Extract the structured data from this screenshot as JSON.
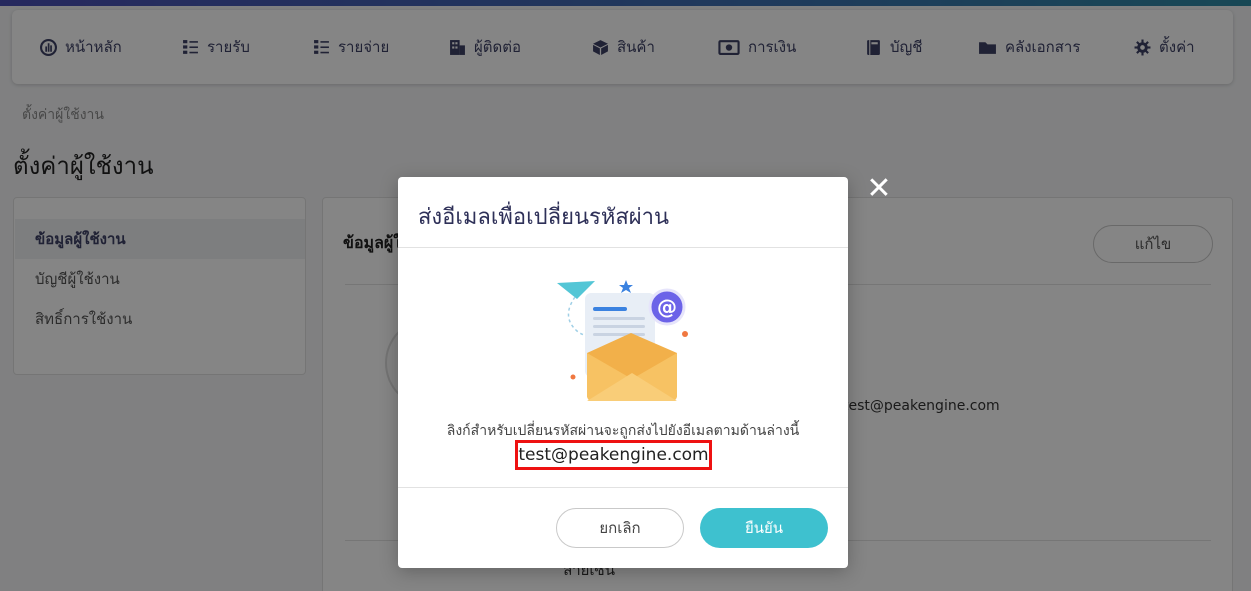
{
  "nav": {
    "items": [
      {
        "label": "หน้าหลัก",
        "icon": "dashboard-icon"
      },
      {
        "label": "รายรับ",
        "icon": "income-list-icon"
      },
      {
        "label": "รายจ่าย",
        "icon": "expense-list-icon"
      },
      {
        "label": "ผู้ติดต่อ",
        "icon": "contacts-building-icon"
      },
      {
        "label": "สินค้า",
        "icon": "product-box-icon"
      },
      {
        "label": "การเงิน",
        "icon": "money-icon"
      },
      {
        "label": "บัญชี",
        "icon": "ledger-book-icon"
      },
      {
        "label": "คลังเอกสาร",
        "icon": "folder-icon"
      },
      {
        "label": "ตั้งค่า",
        "icon": "gear-icon"
      }
    ]
  },
  "breadcrumb": "ตั้งค่าผู้ใช้งาน",
  "page_title": "ตั้งค่าผู้ใช้งาน",
  "sidebar": {
    "items": [
      {
        "label": "ข้อมูลผู้ใช้งาน",
        "active": true
      },
      {
        "label": "บัญชีผู้ใช้งาน",
        "active": false
      },
      {
        "label": "สิทธิ์การใช้งาน",
        "active": false
      }
    ]
  },
  "main": {
    "title": "ข้อมูลผู้ใช้งาน",
    "edit_label": "แก้ไข",
    "email_partial": "test@peakengine.com",
    "bottom_label": "ลายเซ็น"
  },
  "modal": {
    "title": "ส่งอีเมลเพื่อเปลี่ยนรหัสผ่าน",
    "description": "ลิงก์สำหรับเปลี่ยนรหัสผ่านจะถูกส่งไปยังอีเมลตามด้านล่างนี้",
    "email": "test@peakengine.com",
    "cancel_label": "ยกเลิก",
    "confirm_label": "ยืนยัน",
    "close_icon": "close-icon"
  },
  "colors": {
    "accent": "#3ec1cf",
    "nav_text": "#3e4166",
    "highlight_border": "#ee1111",
    "envelope": "#f5b84a",
    "at_badge": "#6c63e8"
  }
}
